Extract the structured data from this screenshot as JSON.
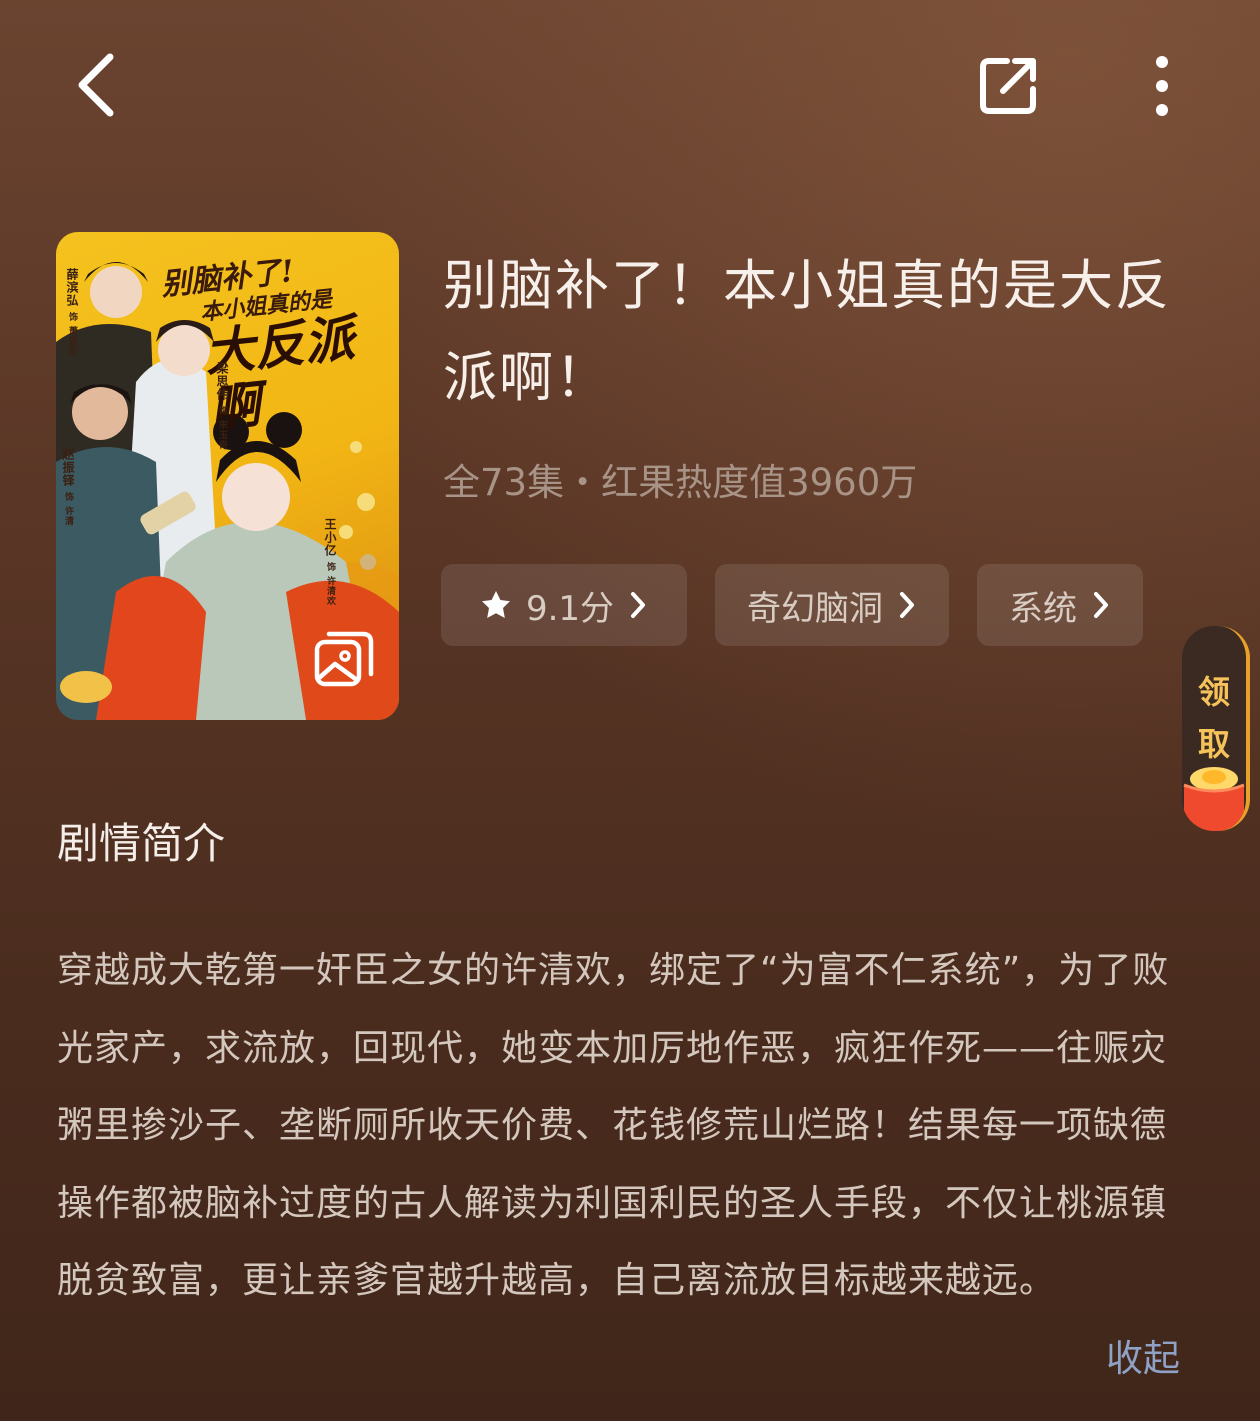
{
  "header": {
    "back_icon": "chevron-left-icon",
    "share_icon": "share-icon",
    "more_icon": "more-vertical-icon"
  },
  "poster": {
    "title_line1": "别脑补了!",
    "title_line2": "本小姐真的是",
    "title_line3": "大反派啊",
    "cast": [
      {
        "name": "薛滨弘",
        "role": "饰 萧景珩"
      },
      {
        "name": "梁思伟",
        "role": "饰 宋玉奇"
      },
      {
        "name": "赵振铎",
        "role": "饰 许清"
      },
      {
        "name": "王小亿",
        "role": "饰 许清欢"
      }
    ],
    "gallery_icon": "gallery-icon"
  },
  "drama": {
    "title": "别脑补了！本小姐真的是大反派啊！",
    "meta": "全73集・红果热度值3960万"
  },
  "chips": [
    {
      "label": "9.1分",
      "icon": "star-icon"
    },
    {
      "label": "奇幻脑洞"
    },
    {
      "label": "系统"
    }
  ],
  "claim": {
    "line1": "领",
    "line2": "取",
    "icon": "treasure-pot-icon",
    "accent": "#e8a22a"
  },
  "synopsis": {
    "heading": "剧情简介",
    "text": "穿越成大乾第一奸臣之女的许清欢，绑定了“为富不仁系统”，为了败光家产，求流放，回现代，她变本加厉地作恶，疯狂作死——往赈灾粥里掺沙子、垄断厕所收天价费、花钱修荒山烂路！结果每一项缺德操作都被脑补过度的古人解读为利国利民的圣人手段，不仅让桃源镇脱贫致富，更让亲爹官越升越高，自己离流放目标越来越远。",
    "collapse_label": "收起",
    "collapse_color": "#8fa2c6"
  }
}
